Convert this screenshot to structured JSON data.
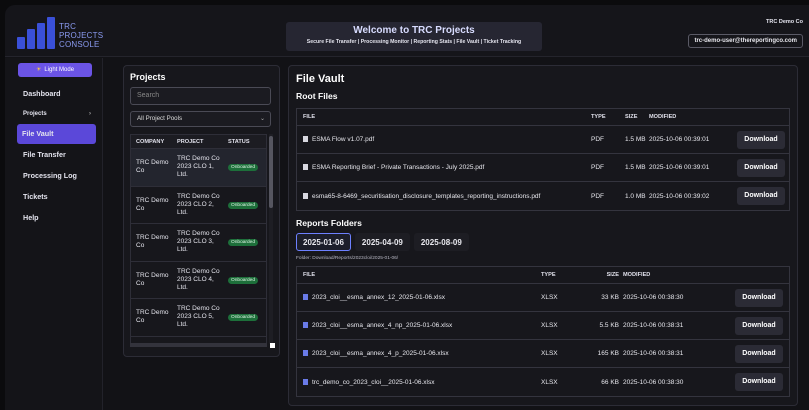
{
  "header": {
    "logo_lines": [
      "TRC",
      "PROJECTS",
      "CONSOLE"
    ],
    "banner_title": "Welcome to TRC Projects",
    "banner_subtitle": "Secure File Transfer | Processing Monitor | Reporting Stats | File Vault | Ticket Tracking",
    "company": "TRC Demo Co",
    "user": "trc-demo-user@thereportingco.com"
  },
  "sidebar": {
    "light_mode_label": "Light Mode",
    "items": [
      {
        "label": "Dashboard"
      },
      {
        "label": "Projects"
      },
      {
        "label": "File Vault"
      },
      {
        "label": "File Transfer"
      },
      {
        "label": "Processing Log"
      },
      {
        "label": "Tickets"
      },
      {
        "label": "Help"
      }
    ]
  },
  "projects": {
    "title": "Projects",
    "search_placeholder": "Search",
    "pool_select": "All Project Pools",
    "columns": [
      "COMPANY",
      "PROJECT",
      "STATUS"
    ],
    "rows": [
      {
        "company": "TRC Demo Co",
        "project": "TRC Demo Co 2023 CLO 1, Ltd.",
        "status": "Onboarded"
      },
      {
        "company": "TRC Demo Co",
        "project": "TRC Demo Co 2023 CLO 2, Ltd.",
        "status": "Onboarded"
      },
      {
        "company": "TRC Demo Co",
        "project": "TRC Demo Co 2023 CLO 3, Ltd.",
        "status": "Onboarded"
      },
      {
        "company": "TRC Demo Co",
        "project": "TRC Demo Co 2023 CLO 4, Ltd.",
        "status": "Onboarded"
      },
      {
        "company": "TRC Demo Co",
        "project": "TRC Demo Co 2023 CLO 5, Ltd.",
        "status": "Onboarded"
      }
    ]
  },
  "vault": {
    "title": "File Vault",
    "root_title": "Root Files",
    "root_columns": [
      "FILE",
      "TYPE",
      "SIZE",
      "MODIFIED"
    ],
    "root_files": [
      {
        "name": "ESMA Flow v1.07.pdf",
        "type": "PDF",
        "size": "1.5 MB",
        "modified": "2025-10-06 00:39:01",
        "action": "Download"
      },
      {
        "name": "ESMA Reporting Brief - Private Transactions - July 2025.pdf",
        "type": "PDF",
        "size": "1.5 MB",
        "modified": "2025-10-06 00:39:01",
        "action": "Download"
      },
      {
        "name": "esma65-8-6469_securitisation_disclosure_templates_reporting_instructions.pdf",
        "type": "PDF",
        "size": "1.0 MB",
        "modified": "2025-10-06 00:39:02",
        "action": "Download"
      }
    ],
    "reports_title": "Reports Folders",
    "folders": [
      "2025-01-06",
      "2025-04-09",
      "2025-08-09"
    ],
    "folder_path": "Folder: Download/Reports/2023cloi/2025-01-06/",
    "report_columns": [
      "FILE",
      "TYPE",
      "SIZE",
      "MODIFIED"
    ],
    "report_files": [
      {
        "name": "2023_cloi__esma_annex_12_2025-01-06.xlsx",
        "type": "XLSX",
        "size": "33 KB",
        "modified": "2025-10-06 00:38:30",
        "action": "Download"
      },
      {
        "name": "2023_cloi__esma_annex_4_np_2025-01-06.xlsx",
        "type": "XLSX",
        "size": "5.5 KB",
        "modified": "2025-10-06 00:38:31",
        "action": "Download"
      },
      {
        "name": "2023_cloi__esma_annex_4_p_2025-01-06.xlsx",
        "type": "XLSX",
        "size": "165 KB",
        "modified": "2025-10-06 00:38:31",
        "action": "Download"
      },
      {
        "name": "trc_demo_co_2023_cloi__2025-01-06.xlsx",
        "type": "XLSX",
        "size": "66 KB",
        "modified": "2025-10-06 00:38:30",
        "action": "Download"
      }
    ]
  }
}
